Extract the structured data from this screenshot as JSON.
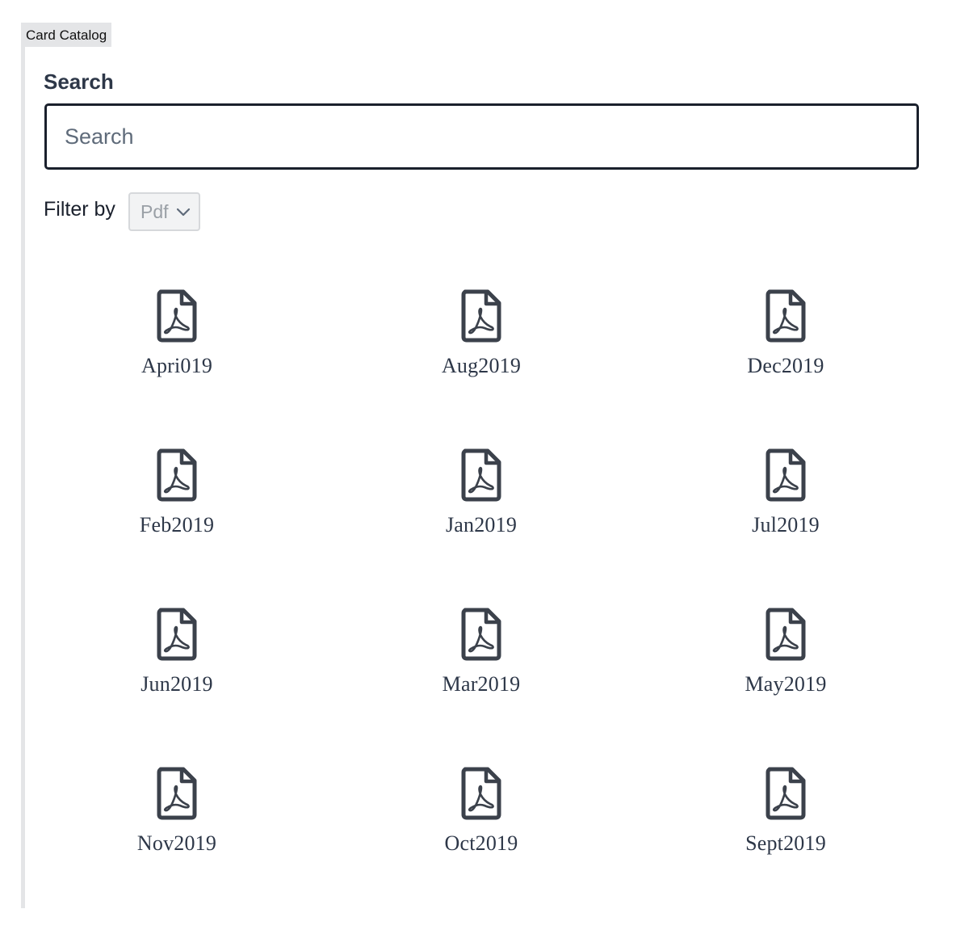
{
  "tab": {
    "label": "Card Catalog"
  },
  "search": {
    "label": "Search",
    "placeholder": "Search",
    "value": ""
  },
  "filter": {
    "label": "Filter by",
    "selected": "Pdf"
  },
  "files": [
    {
      "name": "Apri019",
      "icon": "pdf-file-icon"
    },
    {
      "name": "Aug2019",
      "icon": "pdf-file-icon"
    },
    {
      "name": "Dec2019",
      "icon": "pdf-file-icon"
    },
    {
      "name": "Feb2019",
      "icon": "pdf-file-icon"
    },
    {
      "name": "Jan2019",
      "icon": "pdf-file-icon"
    },
    {
      "name": "Jul2019",
      "icon": "pdf-file-icon"
    },
    {
      "name": "Jun2019",
      "icon": "pdf-file-icon"
    },
    {
      "name": "Mar2019",
      "icon": "pdf-file-icon"
    },
    {
      "name": "May2019",
      "icon": "pdf-file-icon"
    },
    {
      "name": "Nov2019",
      "icon": "pdf-file-icon"
    },
    {
      "name": "Oct2019",
      "icon": "pdf-file-icon"
    },
    {
      "name": "Sept2019",
      "icon": "pdf-file-icon"
    }
  ],
  "colors": {
    "icon": "#3b414b",
    "text": "#2d3748",
    "input_border": "#1a202c"
  }
}
